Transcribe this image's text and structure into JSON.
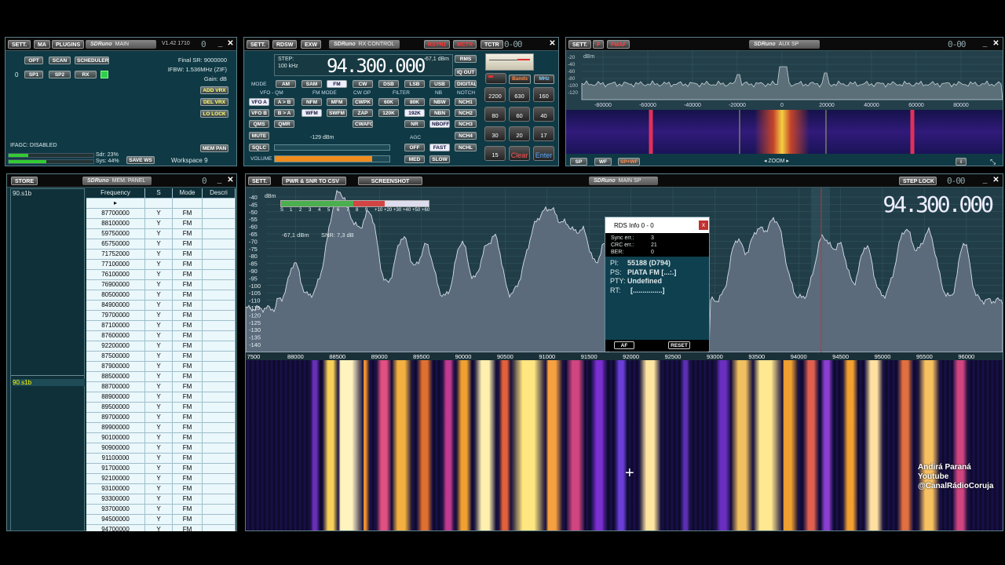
{
  "main": {
    "sett": "SETT.",
    "ma": "MA",
    "plugins": "PLUGINS",
    "logo": "SDRuno",
    "logo_sub": "MAIN",
    "version": "V1.42 1710",
    "opt": "OPT",
    "scan": "SCAN",
    "scheduler": "SCHEDULER",
    "zero": "0",
    "sp1": "SP1",
    "sp2": "SP2",
    "rx": "RX",
    "final_sr": "Final SR: 9000000",
    "ifbw": "IFBW: 1.536MHz (ZIF)",
    "gain": "Gain: dB",
    "add_vrx": "ADD VRX",
    "del_vrx": "DEL VRX",
    "lo_lock": "LO LOCK",
    "ifagc": "IFAGC: DISABLED",
    "sdr": "Sdr: 23%",
    "sys": "Sys: 44%",
    "save_ws": "SAVE WS",
    "workspace": "Workspace 9",
    "mem_pan": "MEM PAN"
  },
  "rx": {
    "sett": "SETT.",
    "rdsw": "RDSW",
    "exw": "EXW",
    "logo": "SDRuno",
    "logo_sub": "RX CONTROL",
    "rsyn": "RSYN1",
    "mctr": "MCTR",
    "tctr": "TCTR",
    "step_label": "STEP:",
    "step_value": "100 kHz",
    "freq": "94.300.000",
    "dbm": "-67,1 dBm",
    "rms": "RMS",
    "iq_out": "IQ OUT",
    "digital": "DIGITAL",
    "mode": "MODE",
    "am": "AM",
    "sam": "SAM",
    "fm": "FM",
    "cw": "CW",
    "dsb": "DSB",
    "lsb": "LSB",
    "usb": "USB",
    "vfo_qm": "VFO - QM",
    "fm_mode": "FM MODE",
    "cw_op": "CW OP",
    "filter": "FILTER",
    "nb": "NB",
    "notch": "NOTCH",
    "vfo_a": "VFO A",
    "a_b": "A > B",
    "nfm": "NFM",
    "mfm": "MFM",
    "cwpk": "CWPK",
    "f60k": "60K",
    "f80k": "80K",
    "nbw": "NBW",
    "nch1": "NCH1",
    "vfo_b": "VFO B",
    "b_a": "B > A",
    "wfm": "WFM",
    "swfm": "SWFM",
    "zap": "ZAP",
    "f120k": "120K",
    "f192k": "192K",
    "nbn": "NBN",
    "nch2": "NCH2",
    "qms": "QMS",
    "qmr": "QMR",
    "cwafc": "CWAFC",
    "nr": "NR",
    "nboff": "NBOFF",
    "nch3": "NCH3",
    "mute": "MUTE",
    "agc": "AGC",
    "nch4": "NCH4",
    "sqlc": "SQLC",
    "sq_dbm": "-129 dBm",
    "off": "OFF",
    "fast": "FAST",
    "nchl": "NCHL",
    "volume": "VOLUME",
    "med": "MED",
    "slow": "SLOW",
    "bands": "Bands",
    "mhz": "MHz",
    "k2200": "2200",
    "k630": "630",
    "k160": "160",
    "k80": "80",
    "k60": "60",
    "k40": "40",
    "k30": "30",
    "k20": "20",
    "k17": "17",
    "k15": "15",
    "clear": "Clear",
    "enter": "Enter",
    "volume_level": 0.85
  },
  "aux": {
    "sett": "SETT.",
    "f": "F",
    "fmaf": "FMAF",
    "logo": "SDRuno",
    "logo_sub": "AUX SP",
    "dbm": "dBm",
    "ticks": [
      "-80000",
      "-60000",
      "-40000",
      "-20000",
      "0",
      "20000",
      "40000",
      "60000",
      "80000"
    ],
    "y_ticks": [
      "-20",
      "-40",
      "-60",
      "-80",
      "-100",
      "-120"
    ],
    "sp": "SP",
    "wf": "WF",
    "spwf": "SP+WF",
    "zoom": "ZOOM",
    "info": "i"
  },
  "mem": {
    "store": "STORE",
    "logo": "SDRuno",
    "logo_sub": "MEM. PANEL",
    "folder": "90.s1b",
    "folder_sel": "90.s1b",
    "cols": [
      "Frequency",
      "S",
      "Mode",
      "Descri"
    ],
    "rows": [
      [
        "87700000",
        "Y",
        "FM"
      ],
      [
        "88100000",
        "Y",
        "FM"
      ],
      [
        "59750000",
        "Y",
        "FM"
      ],
      [
        "65750000",
        "Y",
        "FM"
      ],
      [
        "71752000",
        "Y",
        "FM"
      ],
      [
        "77100000",
        "Y",
        "FM"
      ],
      [
        "76100000",
        "Y",
        "FM"
      ],
      [
        "76900000",
        "Y",
        "FM"
      ],
      [
        "80500000",
        "Y",
        "FM"
      ],
      [
        "84900000",
        "Y",
        "FM"
      ],
      [
        "79700000",
        "Y",
        "FM"
      ],
      [
        "87100000",
        "Y",
        "FM"
      ],
      [
        "87600000",
        "Y",
        "FM"
      ],
      [
        "92200000",
        "Y",
        "FM"
      ],
      [
        "87500000",
        "Y",
        "FM"
      ],
      [
        "87900000",
        "Y",
        "FM"
      ],
      [
        "88500000",
        "Y",
        "FM"
      ],
      [
        "88700000",
        "Y",
        "FM"
      ],
      [
        "88900000",
        "Y",
        "FM"
      ],
      [
        "89500000",
        "Y",
        "FM"
      ],
      [
        "89700000",
        "Y",
        "FM"
      ],
      [
        "89900000",
        "Y",
        "FM"
      ],
      [
        "90100000",
        "Y",
        "FM"
      ],
      [
        "90900000",
        "Y",
        "FM"
      ],
      [
        "91100000",
        "Y",
        "FM"
      ],
      [
        "91700000",
        "Y",
        "FM"
      ],
      [
        "92100000",
        "Y",
        "FM"
      ],
      [
        "93100000",
        "Y",
        "FM"
      ],
      [
        "93300000",
        "Y",
        "FM"
      ],
      [
        "93700000",
        "Y",
        "FM"
      ],
      [
        "94500000",
        "Y",
        "FM"
      ],
      [
        "94700000",
        "Y",
        "FM"
      ]
    ]
  },
  "sp": {
    "sett": "SETT.",
    "pwr_csv": "PWR & SNR TO CSV",
    "screenshot": "SCREENSHOT",
    "logo": "SDRuno",
    "logo_sub": "MAIN SP",
    "step_lock": "STEP LOCK",
    "freq": "94.300.000",
    "dbm": "dBm",
    "y_ticks": [
      "-40",
      "-45",
      "-50",
      "-55",
      "-60",
      "-65",
      "-70",
      "-75",
      "-80",
      "-85",
      "-90",
      "-95",
      "-100",
      "-105",
      "-110",
      "-115",
      "-120",
      "-125",
      "-130",
      "-135",
      "-140"
    ],
    "smeter_ticks": [
      "S",
      "1",
      "2",
      "3",
      "4",
      "5",
      "6",
      "7",
      "8",
      "9",
      "+10",
      "+20",
      "+30",
      "+40",
      "+50",
      "+60"
    ],
    "level": "-67,1 dBm",
    "snr": "SNR: 7,3 dB",
    "x_ticks": [
      "7500",
      "88000",
      "88500",
      "89000",
      "89500",
      "90000",
      "90500",
      "91000",
      "91500",
      "92000",
      "92500",
      "93000",
      "93500",
      "94000",
      "94500",
      "95000",
      "95500",
      "96000"
    ]
  },
  "rds": {
    "title": "RDS Info 0 - 0",
    "sync_label": "Sync err.:",
    "sync": "3",
    "crc_label": "CRC err.:",
    "crc": "21",
    "ber_label": "BER:",
    "ber": "0",
    "pi_label": "PI:",
    "pi": "55188 (D794)",
    "ps_label": "PS:",
    "ps": "PIATA FM [...:.]",
    "pty_label": "PTY:",
    "pty": "Undefined",
    "rt_label": "RT:",
    "rt": "[...............]",
    "af": "AF",
    "reset": "RESET"
  },
  "watermark": {
    "l1": "Andirá Paraná",
    "l2": "Youtube",
    "l3": "@CanalRádioCoruja"
  }
}
